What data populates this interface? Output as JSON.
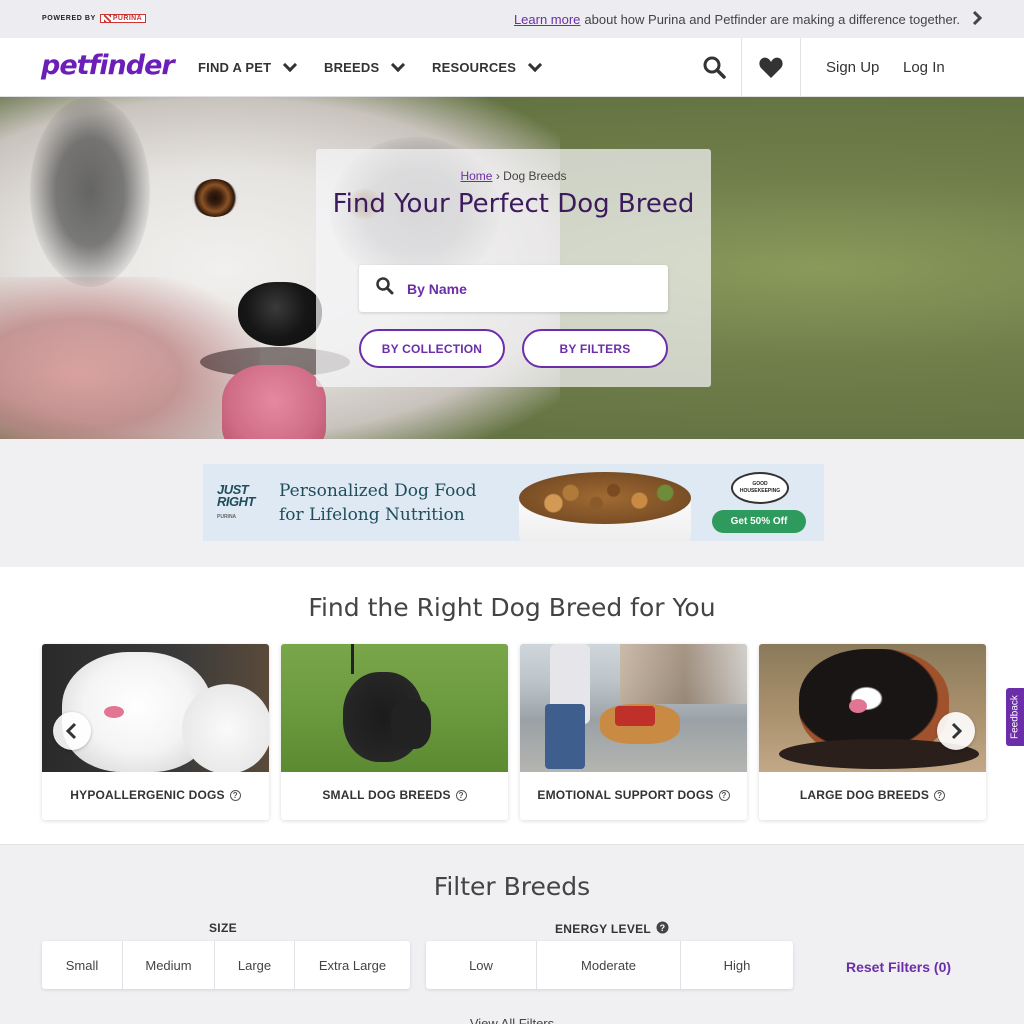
{
  "topbar": {
    "powered_by": "POWERED BY",
    "purina": "PURINA",
    "learn_more": "Learn more",
    "message": "about how Purina and Petfinder are making a difference together."
  },
  "nav": {
    "logo": "petfinder",
    "items": [
      "FIND A PET",
      "BREEDS",
      "RESOURCES"
    ],
    "sign_up": "Sign Up",
    "log_in": "Log In"
  },
  "hero": {
    "breadcrumb_home": "Home",
    "breadcrumb_current": "Dog Breeds",
    "title": "Find Your Perfect Dog Breed",
    "search_placeholder": "By Name",
    "by_collection": "BY COLLECTION",
    "by_filters": "BY FILTERS"
  },
  "ad": {
    "logo_line1": "JUST",
    "logo_line2": "RIGHT",
    "logo_sub": "PURINA",
    "headline_line1": "Personalized Dog Food",
    "headline_line2": "for Lifelong Nutrition",
    "seal": "GOOD HOUSEKEEPING",
    "cta": "Get 50% Off"
  },
  "collections": {
    "title": "Find the Right Dog Breed for You",
    "cards": [
      {
        "label": "HYPOALLERGENIC DOGS"
      },
      {
        "label": "SMALL DOG BREEDS"
      },
      {
        "label": "EMOTIONAL SUPPORT DOGS"
      },
      {
        "label": "LARGE DOG BREEDS"
      }
    ],
    "help_glyph": "?"
  },
  "feedback": "Feedback",
  "filter": {
    "title": "Filter Breeds",
    "size_label": "SIZE",
    "size_options": [
      "Small",
      "Medium",
      "Large",
      "Extra Large"
    ],
    "energy_label": "ENERGY LEVEL",
    "energy_options": [
      "Low",
      "Moderate",
      "High"
    ],
    "reset": "Reset Filters (0)",
    "view_all": "View All Filters"
  },
  "colors": {
    "brand": "#6b2ea8",
    "cta_green": "#2e9a5e"
  }
}
